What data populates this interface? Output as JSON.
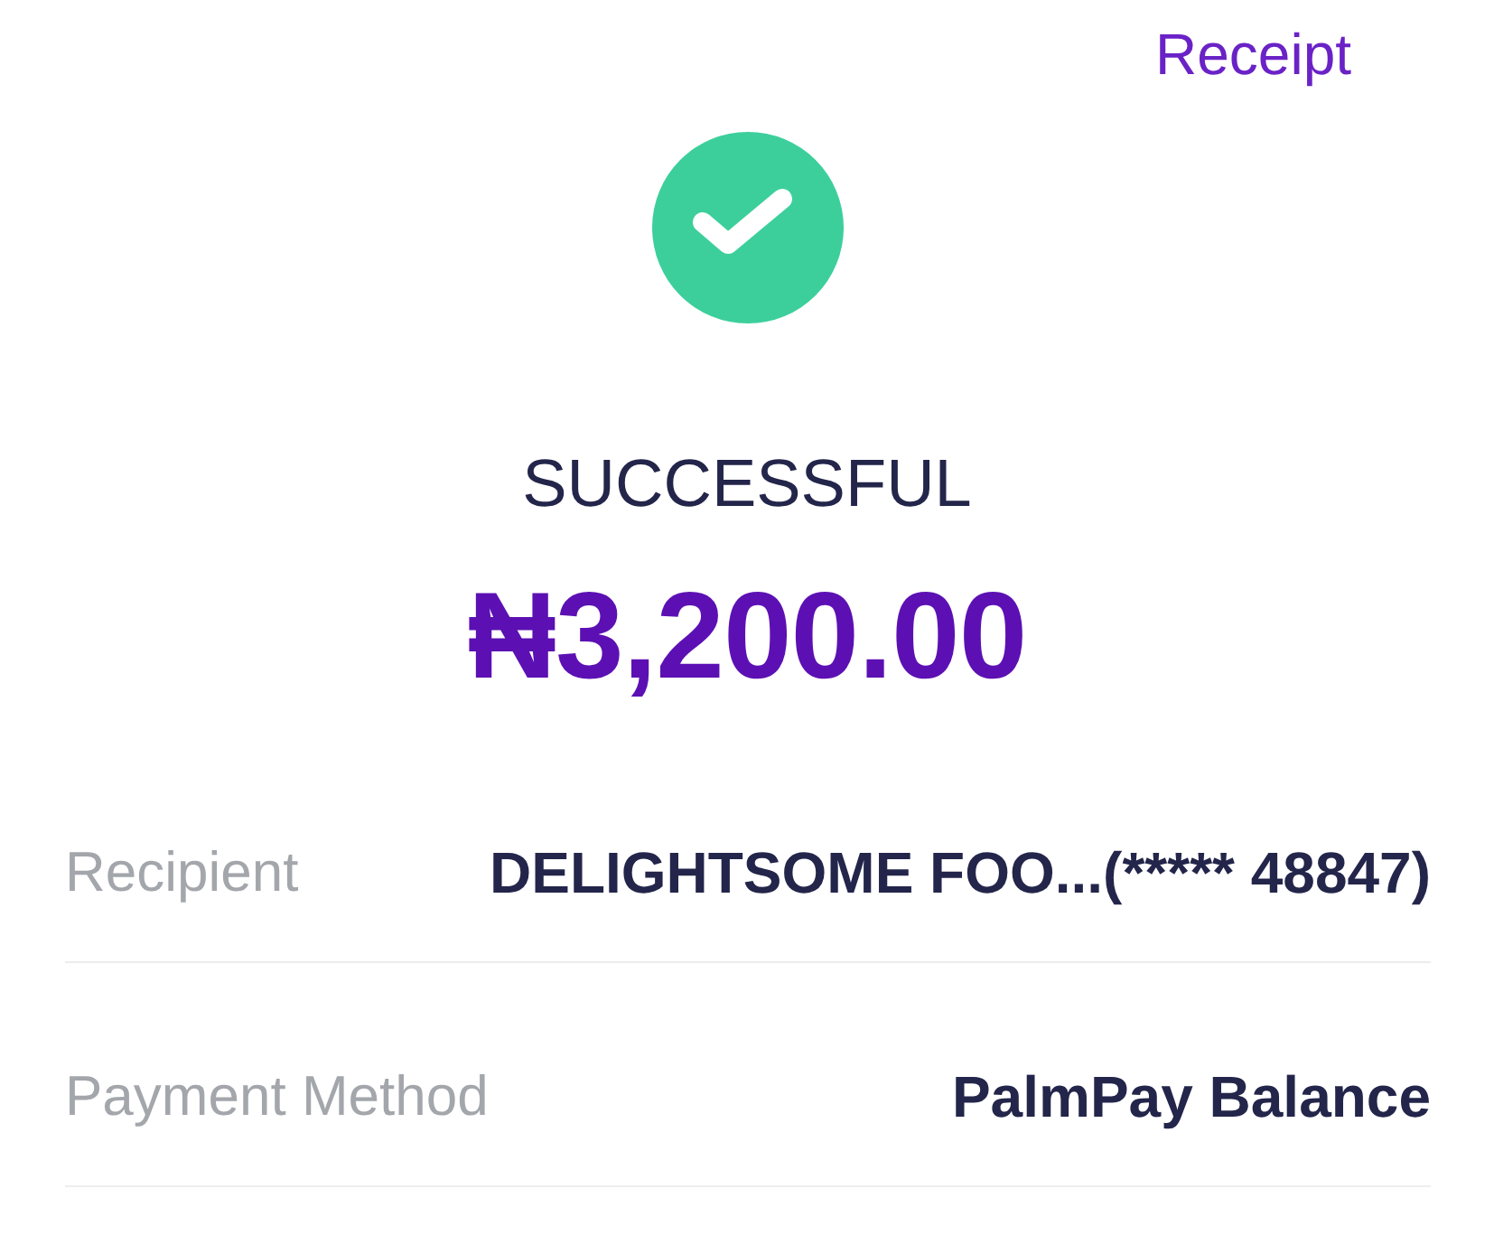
{
  "header": {
    "receipt_link": "Receipt"
  },
  "status": {
    "kind": "success",
    "label": "SUCCESSFUL"
  },
  "amount": "₦3,200.00",
  "details": [
    {
      "label": "Recipient",
      "value": "DELIGHTSOME FOO...(***** 48847)"
    },
    {
      "label": "Payment Method",
      "value": "PalmPay Balance"
    }
  ]
}
